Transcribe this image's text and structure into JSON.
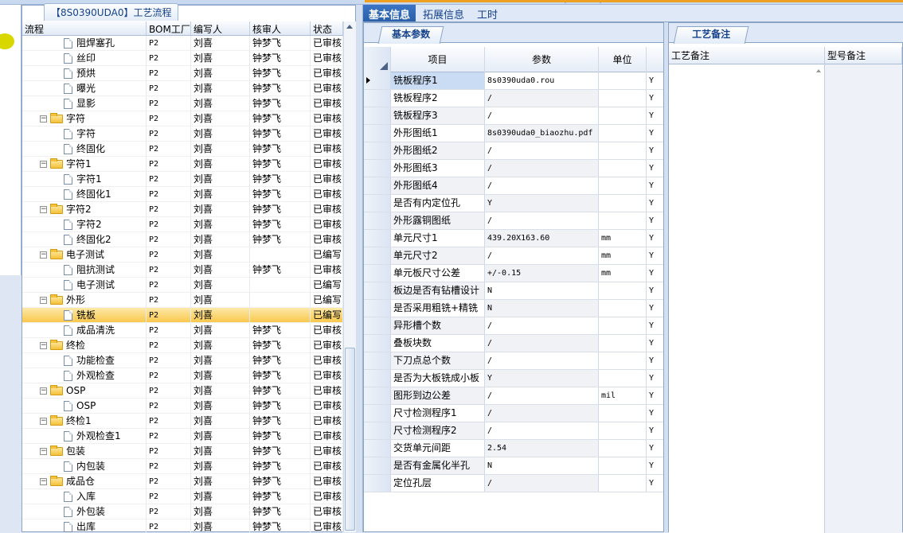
{
  "tree_title": "【8S0390UDA0】工艺流程",
  "tree_columns": [
    "流程",
    "BOM工厂",
    "编写人",
    "核审人",
    "状态"
  ],
  "tree_rows": [
    {
      "name": "阻焊塞孔",
      "level": 2,
      "type": "doc",
      "bom": "P2",
      "writer": "刘喜",
      "reviewer": "钟梦飞",
      "status": "已审核"
    },
    {
      "name": "丝印",
      "level": 2,
      "type": "doc",
      "bom": "P2",
      "writer": "刘喜",
      "reviewer": "钟梦飞",
      "status": "已审核"
    },
    {
      "name": "预烘",
      "level": 2,
      "type": "doc",
      "bom": "P2",
      "writer": "刘喜",
      "reviewer": "钟梦飞",
      "status": "已审核"
    },
    {
      "name": "曝光",
      "level": 2,
      "type": "doc",
      "bom": "P2",
      "writer": "刘喜",
      "reviewer": "钟梦飞",
      "status": "已审核"
    },
    {
      "name": "显影",
      "level": 2,
      "type": "doc",
      "bom": "P2",
      "writer": "刘喜",
      "reviewer": "钟梦飞",
      "status": "已审核"
    },
    {
      "name": "字符",
      "level": 1,
      "type": "folder",
      "bom": "P2",
      "writer": "刘喜",
      "reviewer": "钟梦飞",
      "status": "已审核"
    },
    {
      "name": "字符",
      "level": 2,
      "type": "doc",
      "bom": "P2",
      "writer": "刘喜",
      "reviewer": "钟梦飞",
      "status": "已审核"
    },
    {
      "name": "终固化",
      "level": 2,
      "type": "doc",
      "bom": "P2",
      "writer": "刘喜",
      "reviewer": "钟梦飞",
      "status": "已审核"
    },
    {
      "name": "字符1",
      "level": 1,
      "type": "folder",
      "bom": "P2",
      "writer": "刘喜",
      "reviewer": "钟梦飞",
      "status": "已审核"
    },
    {
      "name": "字符1",
      "level": 2,
      "type": "doc",
      "bom": "P2",
      "writer": "刘喜",
      "reviewer": "钟梦飞",
      "status": "已审核"
    },
    {
      "name": "终固化1",
      "level": 2,
      "type": "doc",
      "bom": "P2",
      "writer": "刘喜",
      "reviewer": "钟梦飞",
      "status": "已审核"
    },
    {
      "name": "字符2",
      "level": 1,
      "type": "folder",
      "bom": "P2",
      "writer": "刘喜",
      "reviewer": "钟梦飞",
      "status": "已审核"
    },
    {
      "name": "字符2",
      "level": 2,
      "type": "doc",
      "bom": "P2",
      "writer": "刘喜",
      "reviewer": "钟梦飞",
      "status": "已审核"
    },
    {
      "name": "终固化2",
      "level": 2,
      "type": "doc",
      "bom": "P2",
      "writer": "刘喜",
      "reviewer": "钟梦飞",
      "status": "已审核"
    },
    {
      "name": "电子测试",
      "level": 1,
      "type": "folder",
      "bom": "P2",
      "writer": "刘喜",
      "reviewer": "",
      "status": "已编写"
    },
    {
      "name": "阻抗测试",
      "level": 2,
      "type": "doc",
      "bom": "P2",
      "writer": "刘喜",
      "reviewer": "钟梦飞",
      "status": "已审核"
    },
    {
      "name": "电子测试",
      "level": 2,
      "type": "doc",
      "bom": "P2",
      "writer": "刘喜",
      "reviewer": "",
      "status": "已编写"
    },
    {
      "name": "外形",
      "level": 1,
      "type": "folder",
      "bom": "P2",
      "writer": "刘喜",
      "reviewer": "",
      "status": "已编写"
    },
    {
      "name": "铣板",
      "level": 2,
      "type": "doc",
      "bom": "P2",
      "writer": "刘喜",
      "reviewer": "",
      "status": "已编写",
      "selected": true
    },
    {
      "name": "成品清洗",
      "level": 2,
      "type": "doc",
      "bom": "P2",
      "writer": "刘喜",
      "reviewer": "钟梦飞",
      "status": "已审核"
    },
    {
      "name": "终检",
      "level": 1,
      "type": "folder",
      "bom": "P2",
      "writer": "刘喜",
      "reviewer": "钟梦飞",
      "status": "已审核"
    },
    {
      "name": "功能检查",
      "level": 2,
      "type": "doc",
      "bom": "P2",
      "writer": "刘喜",
      "reviewer": "钟梦飞",
      "status": "已审核"
    },
    {
      "name": "外观检查",
      "level": 2,
      "type": "doc",
      "bom": "P2",
      "writer": "刘喜",
      "reviewer": "钟梦飞",
      "status": "已审核"
    },
    {
      "name": "OSP",
      "level": 1,
      "type": "folder",
      "bom": "P2",
      "writer": "刘喜",
      "reviewer": "钟梦飞",
      "status": "已审核"
    },
    {
      "name": "OSP",
      "level": 2,
      "type": "doc",
      "bom": "P2",
      "writer": "刘喜",
      "reviewer": "钟梦飞",
      "status": "已审核"
    },
    {
      "name": "终检1",
      "level": 1,
      "type": "folder",
      "bom": "P2",
      "writer": "刘喜",
      "reviewer": "钟梦飞",
      "status": "已审核"
    },
    {
      "name": "外观检查1",
      "level": 2,
      "type": "doc",
      "bom": "P2",
      "writer": "刘喜",
      "reviewer": "钟梦飞",
      "status": "已审核"
    },
    {
      "name": "包装",
      "level": 1,
      "type": "folder",
      "bom": "P2",
      "writer": "刘喜",
      "reviewer": "钟梦飞",
      "status": "已审核"
    },
    {
      "name": "内包装",
      "level": 2,
      "type": "doc",
      "bom": "P2",
      "writer": "刘喜",
      "reviewer": "钟梦飞",
      "status": "已审核"
    },
    {
      "name": "成品仓",
      "level": 1,
      "type": "folder",
      "bom": "P2",
      "writer": "刘喜",
      "reviewer": "钟梦飞",
      "status": "已审核"
    },
    {
      "name": "入库",
      "level": 2,
      "type": "doc",
      "bom": "P2",
      "writer": "刘喜",
      "reviewer": "钟梦飞",
      "status": "已审核"
    },
    {
      "name": "外包装",
      "level": 2,
      "type": "doc",
      "bom": "P2",
      "writer": "刘喜",
      "reviewer": "钟梦飞",
      "status": "已审核"
    },
    {
      "name": "出库",
      "level": 2,
      "type": "doc",
      "bom": "P2",
      "writer": "刘喜",
      "reviewer": "钟梦飞",
      "status": "已审核"
    }
  ],
  "main_tabs": [
    "基本信息",
    "拓展信息",
    "工时"
  ],
  "param_subtab": "基本参数",
  "param_columns": [
    "项目",
    "参数",
    "单位"
  ],
  "param_rows": [
    {
      "item": "铣板程序1",
      "value": "8s0390uda0.rou",
      "unit": "",
      "flag": "Y"
    },
    {
      "item": "铣板程序2",
      "value": "/",
      "unit": "",
      "flag": "Y"
    },
    {
      "item": "铣板程序3",
      "value": "/",
      "unit": "",
      "flag": "Y"
    },
    {
      "item": "外形图纸1",
      "value": "8s0390uda0_biaozhu.pdf",
      "unit": "",
      "flag": "Y"
    },
    {
      "item": "外形图纸2",
      "value": "/",
      "unit": "",
      "flag": "Y"
    },
    {
      "item": "外形图纸3",
      "value": "/",
      "unit": "",
      "flag": "Y"
    },
    {
      "item": "外形图纸4",
      "value": "/",
      "unit": "",
      "flag": "Y"
    },
    {
      "item": "是否有内定位孔",
      "value": "Y",
      "unit": "",
      "flag": "Y"
    },
    {
      "item": "外形露铜图纸",
      "value": "/",
      "unit": "",
      "flag": "Y"
    },
    {
      "item": "单元尺寸1",
      "value": "439.20X163.60",
      "unit": "mm",
      "flag": "Y"
    },
    {
      "item": "单元尺寸2",
      "value": "/",
      "unit": "mm",
      "flag": "Y"
    },
    {
      "item": "单元板尺寸公差",
      "value": "+/-0.15",
      "unit": "mm",
      "flag": "Y"
    },
    {
      "item": "板边是否有钻槽设计",
      "value": "N",
      "unit": "",
      "flag": "Y"
    },
    {
      "item": "是否采用粗铣+精铣",
      "value": "N",
      "unit": "",
      "flag": "Y"
    },
    {
      "item": "异形槽个数",
      "value": "/",
      "unit": "",
      "flag": "Y"
    },
    {
      "item": "叠板块数",
      "value": "/",
      "unit": "",
      "flag": "Y"
    },
    {
      "item": "下刀点总个数",
      "value": "/",
      "unit": "",
      "flag": "Y"
    },
    {
      "item": "是否为大板铣成小板",
      "value": "Y",
      "unit": "",
      "flag": "Y"
    },
    {
      "item": "图形到边公差",
      "value": "/",
      "unit": "mil",
      "flag": "Y"
    },
    {
      "item": "尺寸检测程序1",
      "value": "/",
      "unit": "",
      "flag": "Y"
    },
    {
      "item": "尺寸检测程序2",
      "value": "/",
      "unit": "",
      "flag": "Y"
    },
    {
      "item": "交货单元间距",
      "value": "2.54",
      "unit": "",
      "flag": "Y"
    },
    {
      "item": "是否有金属化半孔",
      "value": "N",
      "unit": "",
      "flag": "Y"
    },
    {
      "item": "定位孔层",
      "value": "/",
      "unit": "",
      "flag": "Y"
    }
  ],
  "remark_tab": "工艺备注",
  "remark_columns": [
    "工艺备注",
    "型号备注"
  ],
  "colors": {
    "accent": "#2a5fa8",
    "selected_row": "#f9c84e",
    "panel_bg": "#dfe8f6"
  }
}
